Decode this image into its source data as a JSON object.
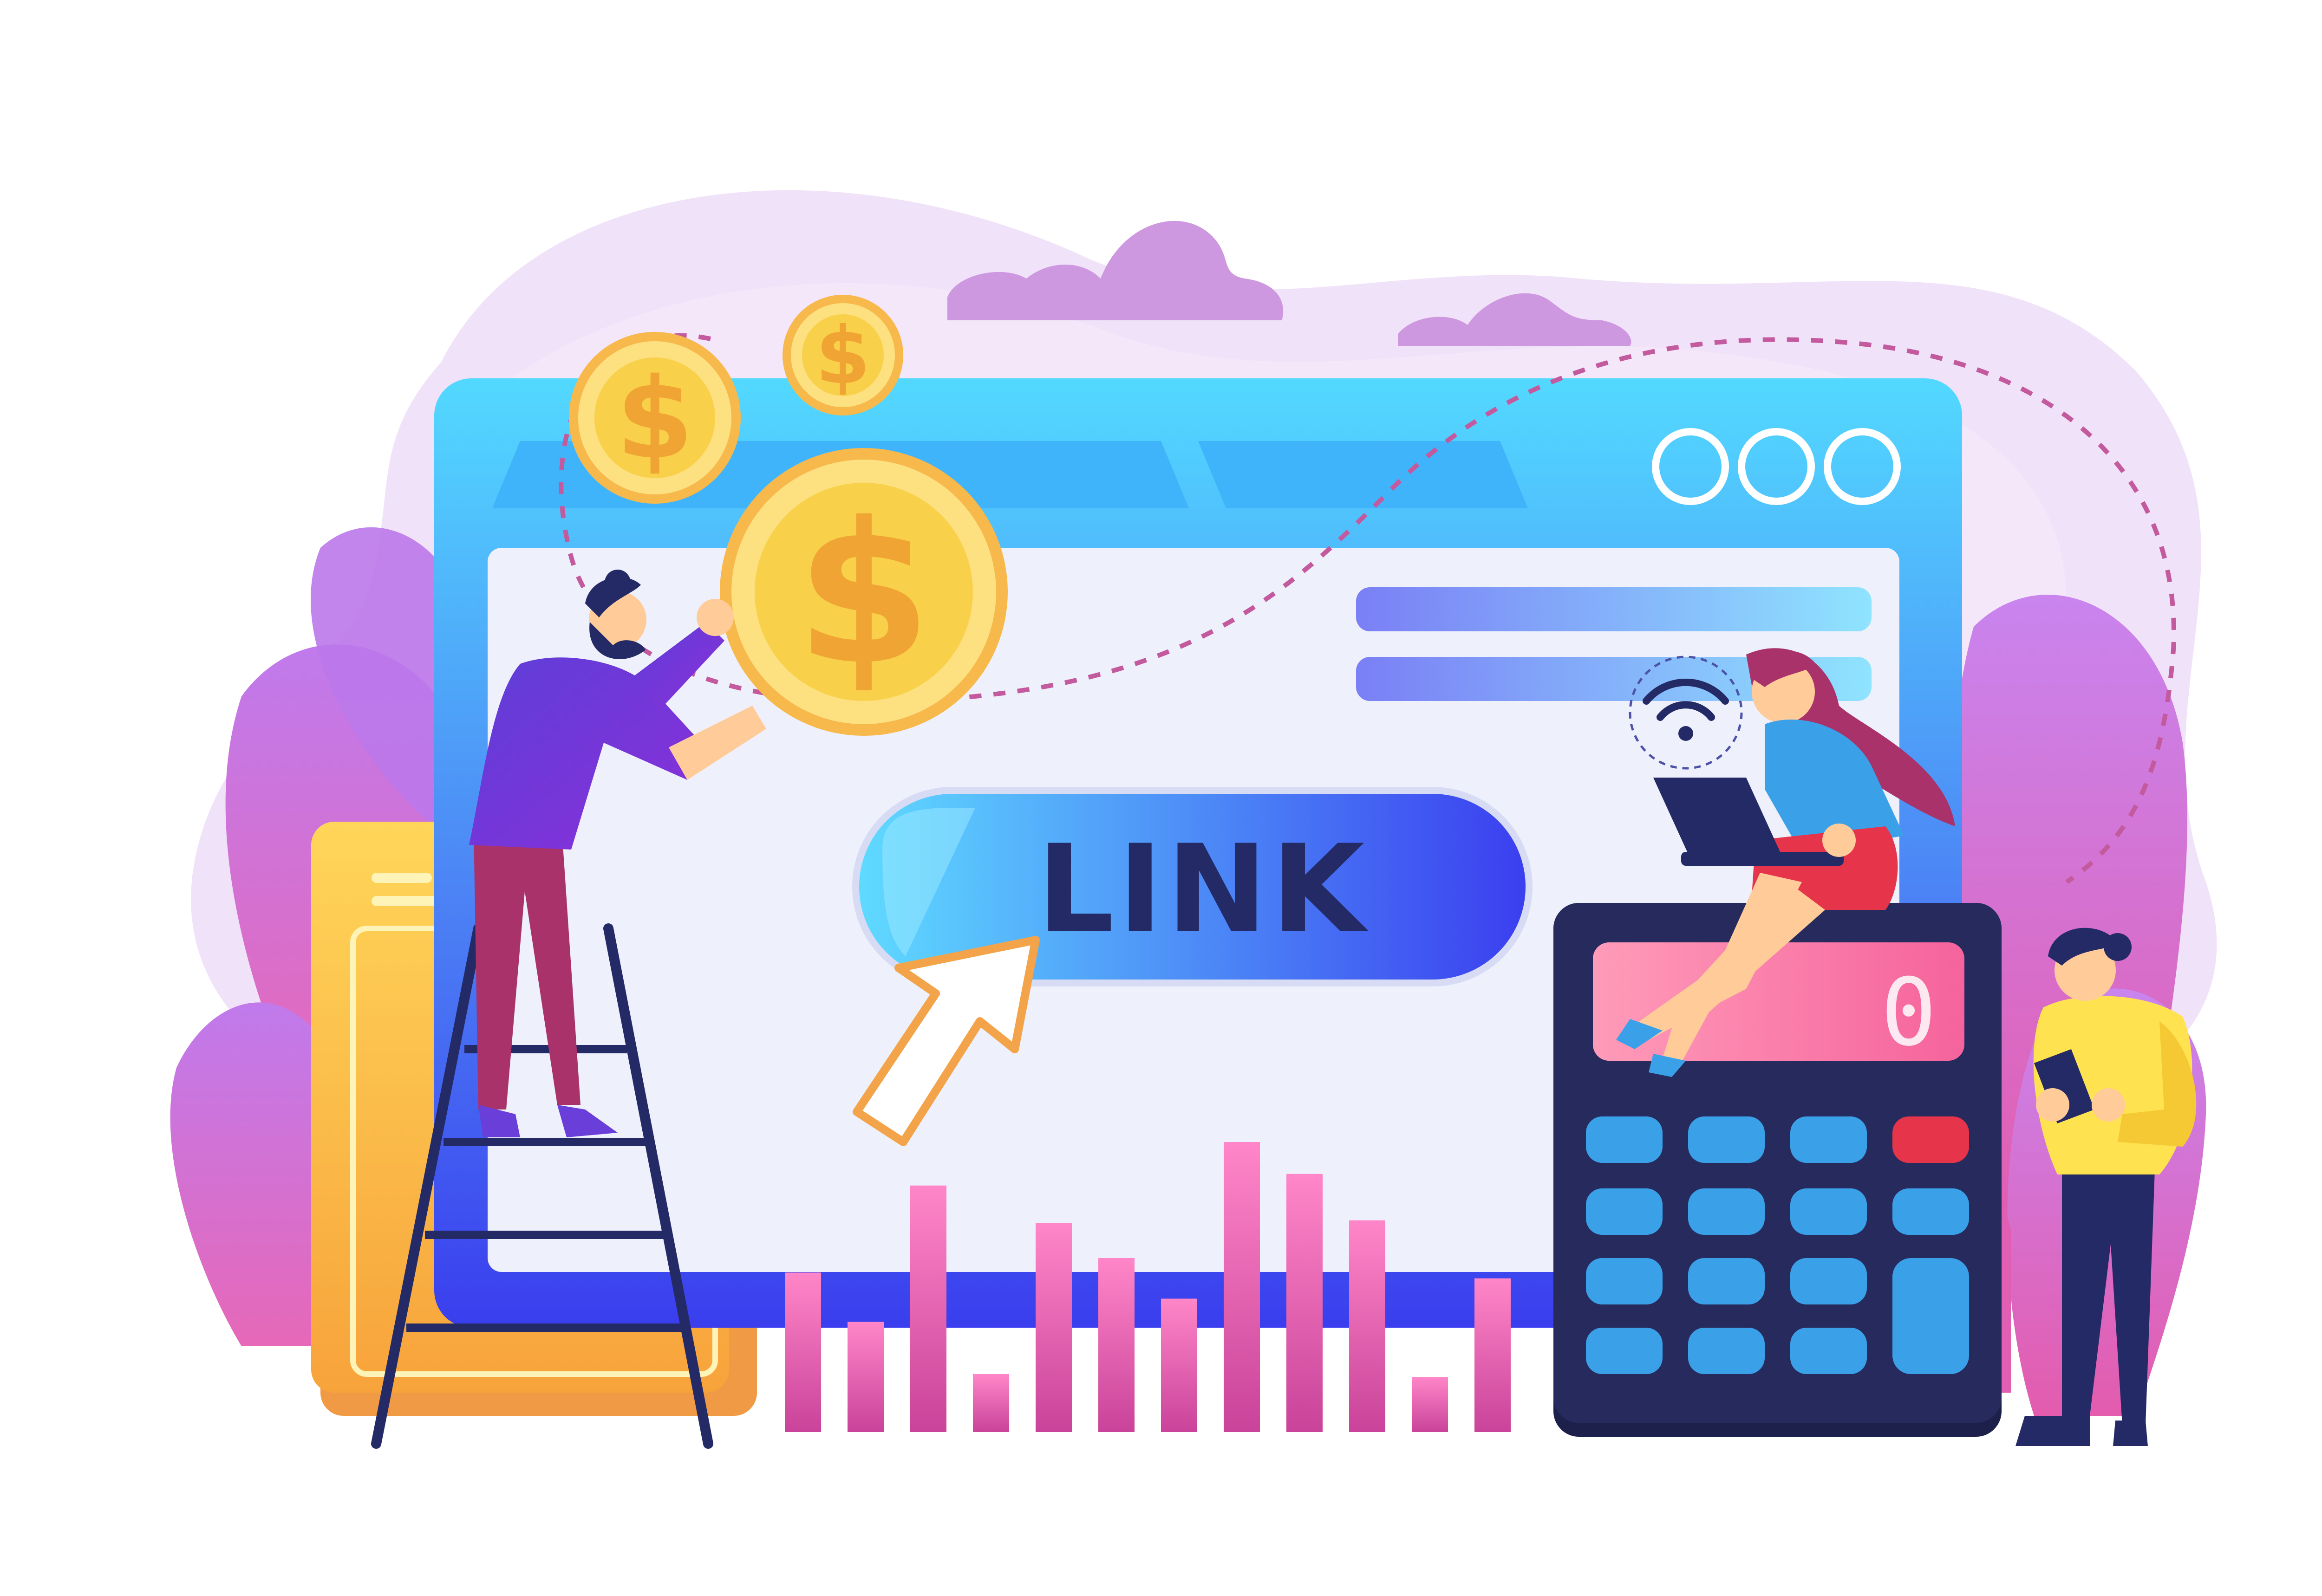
{
  "illustration": {
    "link_button": {
      "label": "LINK"
    },
    "calculator": {
      "display_value": "0"
    },
    "coins": {
      "symbol": "$"
    },
    "browser": {
      "window_controls": [
        "circle-icon",
        "circle-icon",
        "circle-icon"
      ]
    },
    "chart": {
      "bar_levels": [
        0.55,
        0.38,
        0.85,
        0.2,
        0.72,
        0.6,
        0.46,
        1.0,
        0.89,
        0.73,
        0.19,
        0.53
      ]
    }
  },
  "colors": {
    "background": "#ffffff",
    "blob_light": "#efe0f7",
    "cloud": "#cf9ade",
    "leaf_purple": "#b86ae6",
    "leaf_pink": "#e36fbf",
    "browser_frame_top": "#4fd3ff",
    "browser_frame_bottom": "#3b46ef",
    "browser_content": "#eef1fc",
    "link_button_light": "#5fd6ff",
    "link_button_dark": "#3c3ff0",
    "link_text": "#242a66",
    "coin_gold": "#f9d04a",
    "coin_gold_dark": "#f2a932",
    "coin_symbol": "#f0a434",
    "calculator_body": "#262a5c",
    "calculator_display": "#ff7fa8",
    "calculator_key": "#3aa0e8",
    "calculator_key_red": "#e6354a",
    "bar_pink": "#d6488f",
    "bar_top": "#ff7dc2",
    "dashed_path": "#c45a9e"
  }
}
